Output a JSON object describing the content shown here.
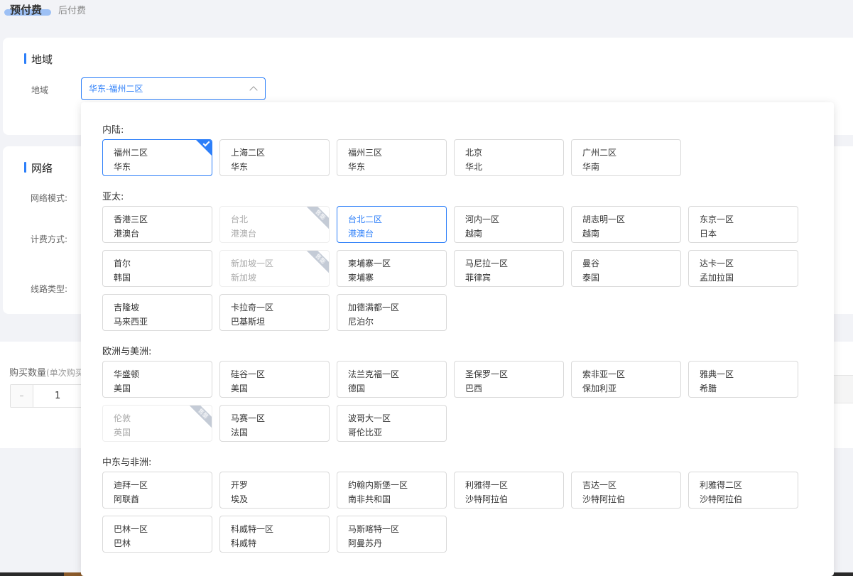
{
  "tabs": {
    "active": "预付费",
    "inactive": "后付费"
  },
  "region_section": {
    "title": "地域",
    "field_label": "地域",
    "selected_value": "华东-福州二区"
  },
  "network_section": {
    "title": "网络",
    "labels": [
      "网络模式:",
      "计费方式:",
      "线路类型:"
    ]
  },
  "quantity": {
    "label": "购买数量",
    "label_sub": "(单次购买",
    "minus": "–",
    "value": "1"
  },
  "colors": {
    "accent": "#2d7ff9",
    "disabled_ribbon": "#c4cbd6"
  },
  "dropdown": {
    "ribbon_text": "售罄",
    "groups": [
      {
        "title": "内陆:",
        "options": [
          {
            "name": "福州二区",
            "area": "华东",
            "state": "selected"
          },
          {
            "name": "上海二区",
            "area": "华东",
            "state": "normal"
          },
          {
            "name": "福州三区",
            "area": "华东",
            "state": "normal"
          },
          {
            "name": "北京",
            "area": "华北",
            "state": "normal"
          },
          {
            "name": "广州二区",
            "area": "华南",
            "state": "normal"
          }
        ]
      },
      {
        "title": "亚太:",
        "options": [
          {
            "name": "香港三区",
            "area": "港澳台",
            "state": "normal"
          },
          {
            "name": "台北",
            "area": "港澳台",
            "state": "disabled"
          },
          {
            "name": "台北二区",
            "area": "港澳台",
            "state": "hover"
          },
          {
            "name": "河内一区",
            "area": "越南",
            "state": "normal"
          },
          {
            "name": "胡志明一区",
            "area": "越南",
            "state": "normal"
          },
          {
            "name": "东京一区",
            "area": "日本",
            "state": "normal"
          },
          {
            "name": "首尔",
            "area": "韩国",
            "state": "normal"
          },
          {
            "name": "新加坡一区",
            "area": "新加坡",
            "state": "disabled"
          },
          {
            "name": "柬埔寨一区",
            "area": "柬埔寨",
            "state": "normal"
          },
          {
            "name": "马尼拉一区",
            "area": "菲律宾",
            "state": "normal"
          },
          {
            "name": "曼谷",
            "area": "泰国",
            "state": "normal"
          },
          {
            "name": "达卡一区",
            "area": "孟加拉国",
            "state": "normal"
          },
          {
            "name": "吉隆坡",
            "area": "马来西亚",
            "state": "normal"
          },
          {
            "name": "卡拉奇一区",
            "area": "巴基斯坦",
            "state": "normal"
          },
          {
            "name": "加德满都一区",
            "area": "尼泊尔",
            "state": "normal"
          }
        ]
      },
      {
        "title": "欧洲与美洲:",
        "options": [
          {
            "name": "华盛顿",
            "area": "美国",
            "state": "normal"
          },
          {
            "name": "硅谷一区",
            "area": "美国",
            "state": "normal"
          },
          {
            "name": "法兰克福一区",
            "area": "德国",
            "state": "normal"
          },
          {
            "name": "圣保罗一区",
            "area": "巴西",
            "state": "normal"
          },
          {
            "name": "索非亚一区",
            "area": "保加利亚",
            "state": "normal"
          },
          {
            "name": "雅典一区",
            "area": "希腊",
            "state": "normal"
          },
          {
            "name": "伦敦",
            "area": "英国",
            "state": "disabled"
          },
          {
            "name": "马赛一区",
            "area": "法国",
            "state": "normal"
          },
          {
            "name": "波哥大一区",
            "area": "哥伦比亚",
            "state": "normal"
          }
        ]
      },
      {
        "title": "中东与非洲:",
        "options": [
          {
            "name": "迪拜一区",
            "area": "阿联酋",
            "state": "normal"
          },
          {
            "name": "开罗",
            "area": "埃及",
            "state": "normal"
          },
          {
            "name": "约翰内斯堡一区",
            "area": "南非共和国",
            "state": "normal"
          },
          {
            "name": "利雅得一区",
            "area": "沙特阿拉伯",
            "state": "normal"
          },
          {
            "name": "吉达一区",
            "area": "沙特阿拉伯",
            "state": "normal"
          },
          {
            "name": "利雅得二区",
            "area": "沙特阿拉伯",
            "state": "normal"
          },
          {
            "name": "巴林一区",
            "area": "巴林",
            "state": "normal"
          },
          {
            "name": "科威特一区",
            "area": "科威特",
            "state": "normal"
          },
          {
            "name": "马斯喀特一区",
            "area": "阿曼苏丹",
            "state": "normal"
          }
        ]
      }
    ]
  }
}
